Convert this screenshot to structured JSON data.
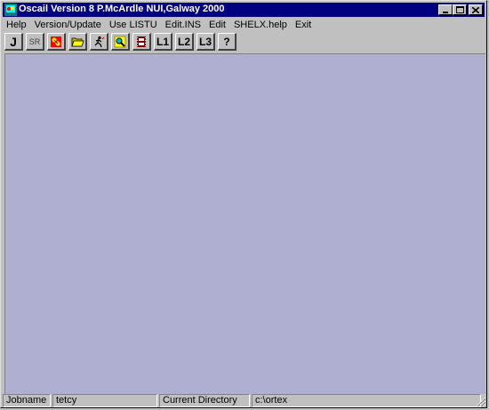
{
  "window": {
    "title": "Oscail Version 8 P.McArdle NUI,Galway 2000",
    "minimize_symbol": "_",
    "maximize_symbol": "□",
    "close_symbol": "✕"
  },
  "menu": {
    "items": [
      {
        "label": "Help"
      },
      {
        "label": "Version/Update"
      },
      {
        "label": "Use LISTU"
      },
      {
        "label": "Edit.INS"
      },
      {
        "label": "Edit"
      },
      {
        "label": "SHELX.help"
      },
      {
        "label": "Exit"
      }
    ]
  },
  "toolbar": {
    "buttons": [
      {
        "icon": "j-icon",
        "label": "J"
      },
      {
        "icon": "sr-icon",
        "label": "SR"
      },
      {
        "icon": "molecule-icon",
        "label": ""
      },
      {
        "icon": "open-folder-icon",
        "label": ""
      },
      {
        "icon": "runner-icon",
        "label": ""
      },
      {
        "icon": "magnifier-icon",
        "label": ""
      },
      {
        "icon": "film-icon",
        "label": ""
      },
      {
        "icon": "l1-icon",
        "label": "L1"
      },
      {
        "icon": "l2-icon",
        "label": "L2"
      },
      {
        "icon": "l3-icon",
        "label": "L3"
      },
      {
        "icon": "question-icon",
        "label": "?"
      }
    ]
  },
  "workspace": {
    "background": "#afafd1"
  },
  "statusbar": {
    "jobname_label": "Jobname",
    "jobname_value": "tetcy",
    "directory_label": "Current Directory",
    "directory_value": "c:\\ortex"
  }
}
